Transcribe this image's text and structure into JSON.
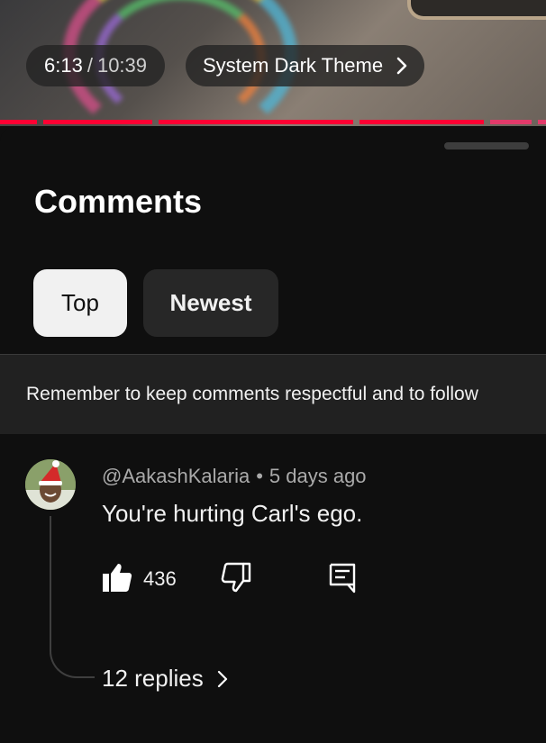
{
  "player": {
    "time_current": "6:13",
    "time_separator": "/",
    "time_total": "10:39",
    "chapter_title": "System Dark Theme",
    "chapter_icon": "chevron-right-icon",
    "progress_color": "#ff0033"
  },
  "comments_sheet": {
    "title": "Comments",
    "sort_chips": [
      {
        "label": "Top",
        "selected": true
      },
      {
        "label": "Newest",
        "selected": false
      }
    ],
    "notice": "Remember to keep comments respectful and to follow"
  },
  "comment": {
    "author": "@AakashKalaria",
    "separator": "•",
    "age": "5 days ago",
    "text": "You're hurting Carl's ego.",
    "likes": "436",
    "like_icon": "thumbs-up-icon",
    "dislike_icon": "thumbs-down-icon",
    "reply_icon": "comment-reply-icon",
    "replies_label": "12 replies"
  }
}
